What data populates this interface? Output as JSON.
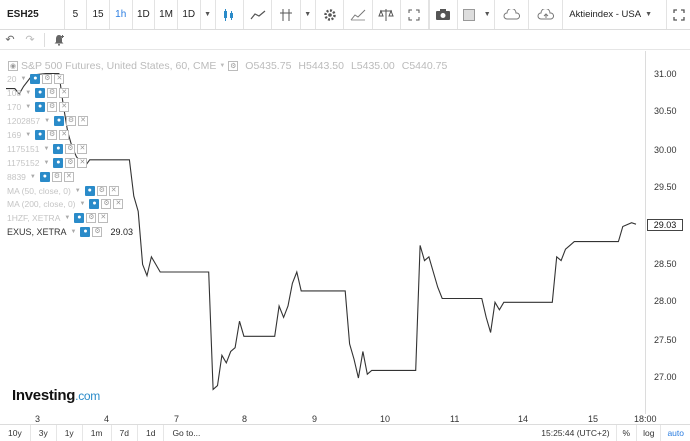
{
  "toolbar": {
    "symbol": "ESH25",
    "intervals": [
      "5",
      "15",
      "1h",
      "1D",
      "1M",
      "1D"
    ],
    "active_interval_index": 2,
    "index_selector": "Aktieindex - USA"
  },
  "legend": {
    "title": "S&P 500 Futures, United States, 60, CME",
    "open": "O5435.75",
    "high": "H5443.50",
    "low": "L5435.00",
    "close": "C5440.75",
    "indicators": [
      {
        "label": "20",
        "top": 73
      },
      {
        "label": "108",
        "top": 87
      },
      {
        "label": "170",
        "top": 101
      },
      {
        "label": "1202857",
        "top": 115
      },
      {
        "label": "169",
        "top": 129
      },
      {
        "label": "1175151",
        "top": 143
      },
      {
        "label": "1175152",
        "top": 157
      },
      {
        "label": "8839",
        "top": 171
      },
      {
        "label": "MA (50, close, 0)",
        "top": 185
      },
      {
        "label": "MA (200, close, 0)",
        "top": 198
      },
      {
        "label": "1HZF, XETRA",
        "top": 212
      }
    ],
    "main_series": "EXUS, XETRA",
    "main_value": "29.03"
  },
  "price_axis": [
    "31.00",
    "30.50",
    "30.00",
    "29.50",
    "28.50",
    "28.00",
    "27.50",
    "27.00"
  ],
  "last_price": "29.03",
  "time_axis": [
    "3",
    "4",
    "7",
    "8",
    "9",
    "10",
    "11",
    "14",
    "15",
    "18:00"
  ],
  "logo": {
    "name": "Investing",
    "suffix": ".com"
  },
  "bottombar": {
    "ranges": [
      "10y",
      "3y",
      "1y",
      "1m",
      "7d",
      "1d",
      "Go to..."
    ],
    "clock": "15:25:44 (UTC+2)",
    "percent": "%",
    "log": "log",
    "auto": "auto"
  },
  "chart_data": {
    "type": "line",
    "series": [
      {
        "name": "EXUS, XETRA",
        "points": [
          [
            0,
            30.82
          ],
          [
            2,
            30.82
          ],
          [
            3,
            30.75
          ],
          [
            4,
            30.85
          ],
          [
            6,
            31.0
          ],
          [
            9,
            31.02
          ],
          [
            12,
            31.02
          ],
          [
            13,
            30.6
          ],
          [
            14,
            30.25
          ],
          [
            15,
            30.05
          ],
          [
            16,
            29.92
          ],
          [
            17,
            29.85
          ],
          [
            18,
            29.8
          ],
          [
            19,
            29.88
          ],
          [
            20,
            29.88
          ],
          [
            28,
            29.88
          ],
          [
            29,
            29.4
          ],
          [
            30,
            29.2
          ],
          [
            31,
            28.5
          ],
          [
            32,
            28.35
          ],
          [
            33,
            28.6
          ],
          [
            34,
            28.5
          ],
          [
            35,
            28.4
          ],
          [
            36,
            28.4
          ],
          [
            46,
            28.4
          ],
          [
            47,
            26.85
          ],
          [
            48,
            26.9
          ],
          [
            49,
            27.3
          ],
          [
            50,
            27.2
          ],
          [
            51,
            27.35
          ],
          [
            52,
            27.4
          ],
          [
            53,
            27.75
          ],
          [
            54,
            27.55
          ],
          [
            61,
            27.55
          ],
          [
            62,
            27.95
          ],
          [
            63,
            27.8
          ],
          [
            64,
            27.95
          ],
          [
            65,
            28.25
          ],
          [
            66,
            28.4
          ],
          [
            67,
            28.15
          ],
          [
            77,
            28.15
          ],
          [
            78,
            27.45
          ],
          [
            79,
            27.25
          ],
          [
            80,
            27.0
          ],
          [
            81,
            27.35
          ],
          [
            82,
            27.05
          ],
          [
            83,
            27.1
          ],
          [
            93,
            27.1
          ],
          [
            94,
            28.75
          ],
          [
            95,
            28.55
          ],
          [
            96,
            28.6
          ],
          [
            97,
            28.4
          ],
          [
            98,
            28.2
          ],
          [
            99,
            28.05
          ],
          [
            108,
            28.05
          ],
          [
            109,
            27.8
          ],
          [
            110,
            27.6
          ],
          [
            111,
            28.0
          ],
          [
            112,
            27.9
          ],
          [
            113,
            28.0
          ],
          [
            124,
            28.0
          ],
          [
            125,
            28.6
          ],
          [
            126,
            28.55
          ],
          [
            127,
            28.7
          ],
          [
            128,
            28.75
          ],
          [
            129,
            28.8
          ],
          [
            139,
            28.8
          ],
          [
            140,
            29.0
          ],
          [
            142,
            29.05
          ],
          [
            143,
            29.03
          ]
        ]
      }
    ],
    "x_ticks": [
      "3",
      "4",
      "7",
      "8",
      "9",
      "10",
      "11",
      "14",
      "15",
      "18:00"
    ],
    "ylim": [
      26.75,
      31.25
    ],
    "grid": false
  }
}
